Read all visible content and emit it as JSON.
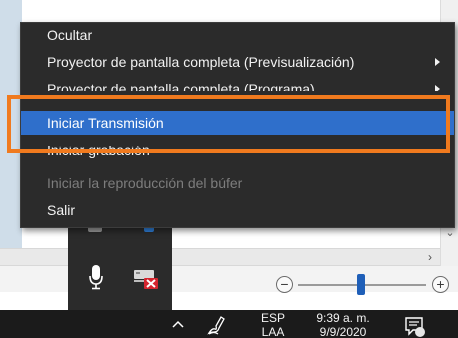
{
  "context_menu": {
    "items": [
      {
        "label": "Ocultar",
        "state": "normal",
        "has_submenu": false
      },
      {
        "label": "Proyector de pantalla completa (Previsualización)",
        "state": "normal",
        "has_submenu": true
      },
      {
        "label": "Proyector de pantalla completa (Programa)",
        "state": "normal",
        "has_submenu": true
      },
      {
        "label": "Iniciar Transmisión",
        "state": "highlighted",
        "has_submenu": false
      },
      {
        "label": "Iniciar grabación",
        "state": "normal",
        "has_submenu": false
      },
      {
        "label": "Iniciar la reproducción del búfer",
        "state": "disabled",
        "has_submenu": false
      },
      {
        "label": "Salir",
        "state": "normal",
        "has_submenu": false
      }
    ],
    "highlight_frame_color": "#f07a1e",
    "selection_color": "#2f6fcb"
  },
  "tray_flyout": {
    "icons": [
      "microphone-icon",
      "network-device-error-icon"
    ]
  },
  "taskbar": {
    "language": "ESP",
    "language_sub": "LAA",
    "time": "9:39 a. m.",
    "date": "9/9/2020",
    "icons": [
      "chevron-up-icon",
      "pen-icon",
      "notification-icon"
    ]
  },
  "zoom": {
    "minus": "−",
    "plus": "+"
  }
}
